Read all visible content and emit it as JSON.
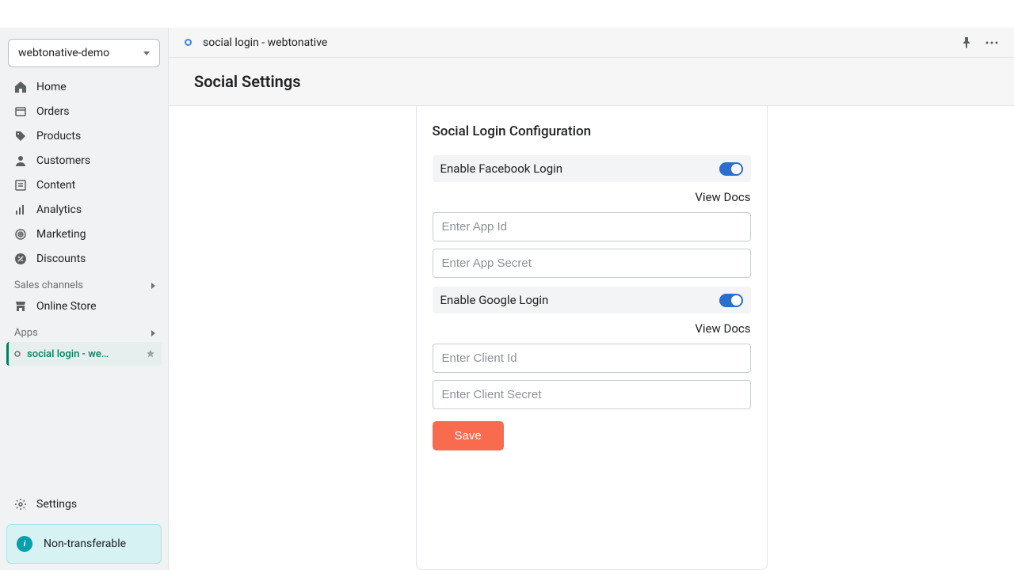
{
  "store_name": "webtonative-demo",
  "nav": {
    "items": [
      {
        "label": "Home",
        "icon": "home"
      },
      {
        "label": "Orders",
        "icon": "orders"
      },
      {
        "label": "Products",
        "icon": "products"
      },
      {
        "label": "Customers",
        "icon": "customers"
      },
      {
        "label": "Content",
        "icon": "content"
      },
      {
        "label": "Analytics",
        "icon": "analytics"
      },
      {
        "label": "Marketing",
        "icon": "marketing"
      },
      {
        "label": "Discounts",
        "icon": "discounts"
      }
    ],
    "sales_channels_label": "Sales channels",
    "online_store_label": "Online Store",
    "apps_label": "Apps",
    "app_item_label": "social login - webto...",
    "settings_label": "Settings",
    "notice_text": "Non-transferable"
  },
  "topbar": {
    "app_title": "social login - webtonative"
  },
  "page": {
    "title": "Social Settings"
  },
  "card": {
    "title": "Social Login Configuration",
    "facebook": {
      "toggle_label": "Enable Facebook Login",
      "enabled": true,
      "view_docs": "View Docs",
      "app_id_placeholder": "Enter App Id",
      "app_secret_placeholder": "Enter App Secret"
    },
    "google": {
      "toggle_label": "Enable Google Login",
      "enabled": true,
      "view_docs": "View Docs",
      "client_id_placeholder": "Enter Client Id",
      "client_secret_placeholder": "Enter Client Secret"
    },
    "save_label": "Save"
  }
}
